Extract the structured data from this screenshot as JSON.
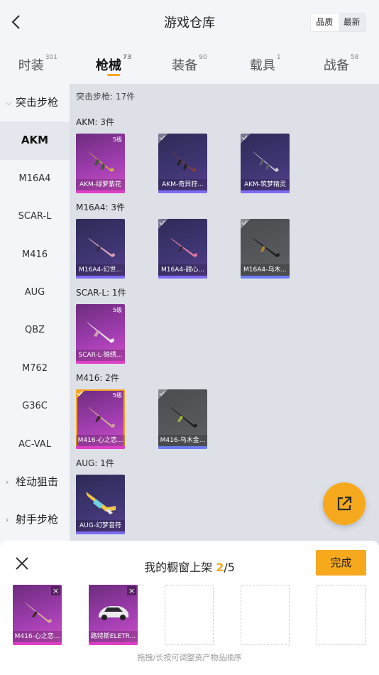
{
  "header": {
    "title": "游戏仓库",
    "sort_quality": "品质",
    "sort_latest": "最新"
  },
  "tabs": [
    {
      "label": "时装",
      "count": "301"
    },
    {
      "label": "枪械",
      "count": "73"
    },
    {
      "label": "装备",
      "count": "90"
    },
    {
      "label": "载具",
      "count": "1"
    },
    {
      "label": "战备",
      "count": "58"
    }
  ],
  "sidebar": {
    "group_assault": "突击步枪",
    "items": [
      "AKM",
      "M16A4",
      "SCAR-L",
      "M416",
      "AUG",
      "QBZ",
      "M762",
      "G36C",
      "AC-VAL"
    ],
    "group_bolt": "栓动狙击",
    "group_marksman": "射手步枪"
  },
  "content": {
    "category_header": "突击步枪: 17件",
    "sections": [
      {
        "header": "AKM: 3件",
        "items": [
          {
            "name": "AKM-绿萝紫花",
            "level": "5级",
            "rarity": "pink"
          },
          {
            "name": "AKM-奇异狩...",
            "rarity": "purple"
          },
          {
            "name": "AKM-筑梦精灵",
            "rarity": "purple"
          }
        ]
      },
      {
        "header": "M16A4: 3件",
        "items": [
          {
            "name": "M16A4-幻世...",
            "rarity": "purple"
          },
          {
            "name": "M16A4-甜心...",
            "rarity": "purple"
          },
          {
            "name": "M16A4-乌木...",
            "rarity": "gray"
          }
        ]
      },
      {
        "header": "SCAR-L: 1件",
        "items": [
          {
            "name": "SCAR-L-锦绣...",
            "level": "5级",
            "rarity": "pink"
          }
        ]
      },
      {
        "header": "M416: 2件",
        "items": [
          {
            "name": "M416-心之恋...",
            "level": "5级",
            "rarity": "pink",
            "selected": true
          },
          {
            "name": "M416-乌木金...",
            "rarity": "gray"
          }
        ]
      },
      {
        "header": "AUG: 1件",
        "items": [
          {
            "name": "AUG-幻梦音符",
            "rarity": "purple"
          }
        ]
      }
    ]
  },
  "panel": {
    "title_prefix": "我的橱窗上架 ",
    "count": "2",
    "title_suffix": "/5",
    "done_label": "完成",
    "slots": [
      {
        "name": "M416-心之恋..."
      },
      {
        "name": "路特斯ELETR..."
      }
    ],
    "hint": "拖拽/长按可调整资产物品顺序"
  },
  "colors": {
    "accent": "#f7a91e",
    "pink_rarity": "#e040c8",
    "purple_rarity": "#7c6cf4"
  }
}
